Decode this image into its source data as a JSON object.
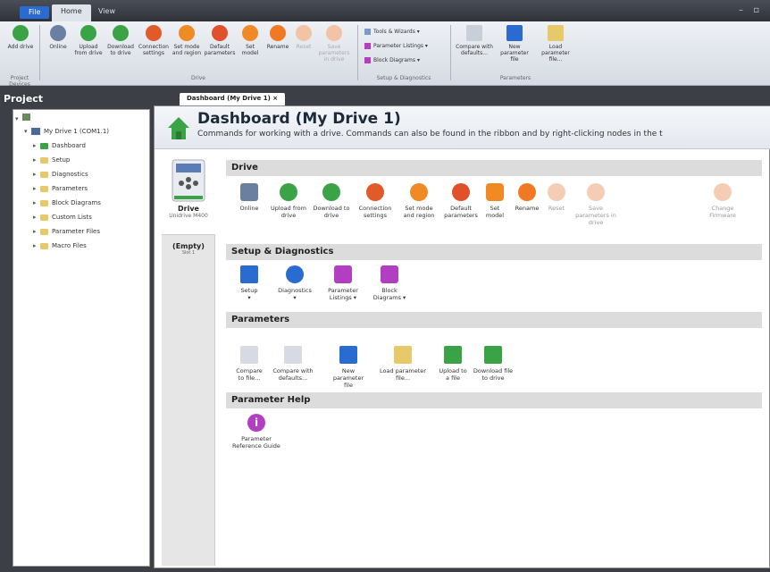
{
  "tabs": {
    "file": "File",
    "home": "Home",
    "view": "View"
  },
  "window_controls": "– ▫",
  "ribbon": {
    "add_drive": "Add drive",
    "project_devices": "Project Devices",
    "online": "Online",
    "upload_from_drive": "Upload from drive",
    "download_to_drive": "Download to drive",
    "connection_settings": "Connection settings",
    "set_mode_region": "Set mode and region",
    "default_parameters": "Default parameters",
    "set_model": "Set model",
    "rename": "Rename",
    "reset": "Reset",
    "save_parameters_drive": "Save parameters in drive",
    "drive_group": "Drive",
    "tools_wizards": "Tools & Wizards",
    "parameter_listings": "Parameter Listings",
    "block_diagrams": "Block Diagrams",
    "setup_diag_group": "Setup & Diagnostics",
    "compare_defaults": "Compare with defaults...",
    "new_param_file": "New parameter file",
    "load_param_file": "Load parameter file...",
    "parameters_group": "Parameters"
  },
  "project": {
    "header": "Project",
    "root": "My Drive 1 (COM1.1)",
    "items": [
      "Dashboard",
      "Setup",
      "Diagnostics",
      "Parameters",
      "Block Diagrams",
      "Custom Lists",
      "Parameter Files",
      "Macro Files"
    ]
  },
  "doc_tab": "Dashboard (My Drive 1) ×",
  "dashboard": {
    "title": "Dashboard (My Drive 1)",
    "subtitle": "Commands for working with a drive. Commands can also be found in the ribbon and by right-clicking nodes in the t"
  },
  "left": {
    "drive_label": "Drive",
    "drive_model": "Unidrive M400",
    "empty_label": "(Empty)",
    "empty_sub": "Slot 1"
  },
  "sections": {
    "drive": "Drive",
    "setup": "Setup & Diagnostics",
    "parameters": "Parameters",
    "help": "Parameter Help"
  },
  "drive_buttons": [
    "Online",
    "Upload from drive",
    "Download to drive",
    "Connection settings",
    "Set mode and region",
    "Default parameters",
    "Set model",
    "Rename",
    "Reset",
    "Save parameters in drive",
    "Change Firmware"
  ],
  "setup_buttons": [
    "Setup",
    "Diagnostics",
    "Parameter Listings ▾",
    "Block Diagrams ▾"
  ],
  "param_buttons": [
    "Compare to file...",
    "Compare with defaults...",
    "New parameter file",
    "Load parameter file...",
    "Upload to a file",
    "Download file to drive"
  ],
  "help_buttons": [
    "Parameter Reference Guide"
  ],
  "colors": {
    "accent": "#2a6bd1",
    "green": "#3aa345",
    "orange": "#f08a24",
    "purple": "#b23fc1"
  }
}
